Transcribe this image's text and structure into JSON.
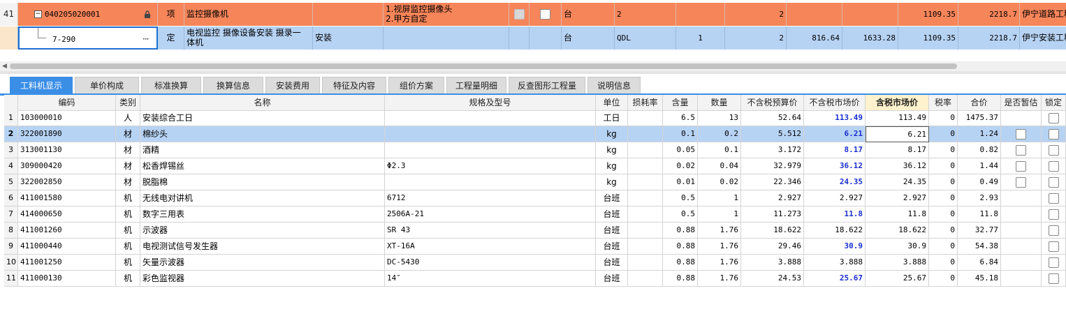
{
  "top_rows": [
    {
      "row_num": "41",
      "code": "040205020001",
      "type": "项",
      "name": "监控摄像机",
      "spec": "",
      "feature_line1": "1.视屏监控摄像头",
      "feature_line2": "2.甲方自定",
      "unit": "台",
      "expr": "2",
      "qty_coef": "",
      "qty": "2",
      "price_a": "",
      "price_b": "",
      "unit_price": "1109.35",
      "total": "2218.7",
      "profession": "伊宁道路工程"
    },
    {
      "row_num": "",
      "code": "7-290",
      "type": "定",
      "name_line1": "电视监控 摄像设备安装 摄录一",
      "name_line2": "体机",
      "spec": "安装",
      "unit": "台",
      "expr": "QDL",
      "qty_coef": "1",
      "qty": "2",
      "price_a": "816.64",
      "price_b": "1633.28",
      "unit_price": "1109.35",
      "total": "2218.7",
      "profession": "伊宁安装工程"
    }
  ],
  "tabs": [
    "工料机显示",
    "单价构成",
    "标准换算",
    "换算信息",
    "安装费用",
    "特征及内容",
    "组价方案",
    "工程量明细",
    "反查图形工程量",
    "说明信息"
  ],
  "active_tab": "工料机显示",
  "columns": [
    "编码",
    "类别",
    "名称",
    "规格及型号",
    "单位",
    "损耗率",
    "含量",
    "数量",
    "不含税预算价",
    "不含税市场价",
    "含税市场价",
    "税率",
    "合价",
    "是否暂估",
    "锁定"
  ],
  "rows": [
    {
      "n": "1",
      "code": "103000010",
      "cat": "人",
      "name": "安装综合工日",
      "spec": "",
      "unit": "工日",
      "loss": "",
      "content": "6.5",
      "qty": "13",
      "budget": "52.64",
      "market": "113.49",
      "market_tax": "113.49",
      "rate": "0",
      "total": "1475.37",
      "est": false,
      "blue": true
    },
    {
      "n": "2",
      "code": "322001890",
      "cat": "材",
      "name": "棉纱头",
      "spec": "",
      "unit": "kg",
      "loss": "",
      "content": "0.1",
      "qty": "0.2",
      "budget": "5.512",
      "market": "6.21",
      "market_tax": "6.21",
      "rate": "0",
      "total": "1.24",
      "est": true,
      "blue": true
    },
    {
      "n": "3",
      "code": "313001130",
      "cat": "材",
      "name": "酒精",
      "spec": "",
      "unit": "kg",
      "loss": "",
      "content": "0.05",
      "qty": "0.1",
      "budget": "3.172",
      "market": "8.17",
      "market_tax": "8.17",
      "rate": "0",
      "total": "0.82",
      "est": true,
      "blue": true
    },
    {
      "n": "4",
      "code": "309000420",
      "cat": "材",
      "name": "松香焊锡丝",
      "spec": "Φ2.3",
      "unit": "kg",
      "loss": "",
      "content": "0.02",
      "qty": "0.04",
      "budget": "32.979",
      "market": "36.12",
      "market_tax": "36.12",
      "rate": "0",
      "total": "1.44",
      "est": true,
      "blue": true
    },
    {
      "n": "5",
      "code": "322002850",
      "cat": "材",
      "name": "脱脂棉",
      "spec": "",
      "unit": "kg",
      "loss": "",
      "content": "0.01",
      "qty": "0.02",
      "budget": "22.346",
      "market": "24.35",
      "market_tax": "24.35",
      "rate": "0",
      "total": "0.49",
      "est": true,
      "blue": true
    },
    {
      "n": "6",
      "code": "411001580",
      "cat": "机",
      "name": "无线电对讲机",
      "spec": "6712",
      "unit": "台班",
      "loss": "",
      "content": "0.5",
      "qty": "1",
      "budget": "2.927",
      "market": "2.927",
      "market_tax": "2.927",
      "rate": "0",
      "total": "2.93",
      "est": false,
      "blue": false
    },
    {
      "n": "7",
      "code": "414000650",
      "cat": "机",
      "name": "数字三用表",
      "spec": "2506A-21",
      "unit": "台班",
      "loss": "",
      "content": "0.5",
      "qty": "1",
      "budget": "11.273",
      "market": "11.8",
      "market_tax": "11.8",
      "rate": "0",
      "total": "11.8",
      "est": false,
      "blue": true
    },
    {
      "n": "8",
      "code": "411001260",
      "cat": "机",
      "name": "示波器",
      "spec": "SR 43",
      "unit": "台班",
      "loss": "",
      "content": "0.88",
      "qty": "1.76",
      "budget": "18.622",
      "market": "18.622",
      "market_tax": "18.622",
      "rate": "0",
      "total": "32.77",
      "est": false,
      "blue": false
    },
    {
      "n": "9",
      "code": "411000440",
      "cat": "机",
      "name": "电视测试信号发生器",
      "spec": "XT-16A",
      "unit": "台班",
      "loss": "",
      "content": "0.88",
      "qty": "1.76",
      "budget": "29.46",
      "market": "30.9",
      "market_tax": "30.9",
      "rate": "0",
      "total": "54.38",
      "est": false,
      "blue": true
    },
    {
      "n": "10",
      "code": "411001250",
      "cat": "机",
      "name": "矢量示波器",
      "spec": "DC-5430",
      "unit": "台班",
      "loss": "",
      "content": "0.88",
      "qty": "1.76",
      "budget": "3.888",
      "market": "3.888",
      "market_tax": "3.888",
      "rate": "0",
      "total": "6.84",
      "est": false,
      "blue": false
    },
    {
      "n": "11",
      "code": "411000130",
      "cat": "机",
      "name": "彩色监视器",
      "spec": "14″",
      "unit": "台班",
      "loss": "",
      "content": "0.88",
      "qty": "1.76",
      "budget": "24.53",
      "market": "25.67",
      "market_tax": "25.67",
      "rate": "0",
      "total": "45.18",
      "est": false,
      "blue": true
    }
  ],
  "colors": {
    "item_row": "#f7855a",
    "selected_row": "#b7d3f4",
    "tab_active": "#3a8ee6",
    "highlight_header": "#fff2cc",
    "market_price": "#1a2fd0"
  },
  "icons": {
    "lock": "lock-icon",
    "ellipsis": "more-icon",
    "collapse": "collapse-icon"
  }
}
